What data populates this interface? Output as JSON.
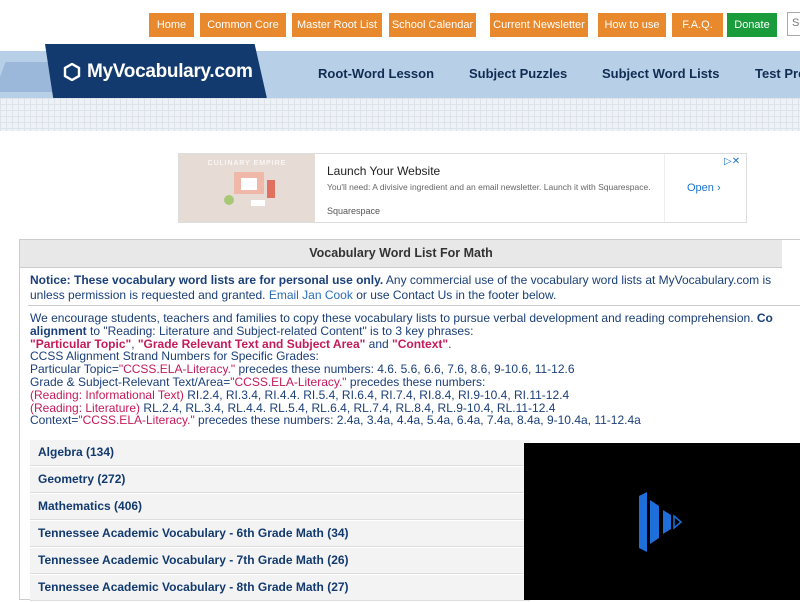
{
  "topnav": {
    "items": [
      "Home",
      "Common Core",
      "Master Root List",
      "School Calendar",
      "Current Newsletter",
      "How to use",
      "F.A.Q.",
      "Donate"
    ]
  },
  "search": {
    "placeholder": "Se"
  },
  "logo": {
    "text": "MyVocabulary.com"
  },
  "catnav": {
    "items": [
      "Root-Word Lesson",
      "Subject Puzzles",
      "Subject Word Lists",
      "Test Pre"
    ]
  },
  "ad": {
    "image_title": "CULINARY EMPIRE",
    "title": "Launch Your Website",
    "description": "You'll need: A divisive ingredient and an email newsletter. Launch it with Squarespace.",
    "brand": "Squarespace",
    "cta": "Open",
    "badges": "▷✕"
  },
  "main": {
    "header": "Vocabulary Word List For Math",
    "notice_bold": "Notice: These vocabulary word lists are for personal use only.",
    "notice_rest": " Any commercial use of the vocabulary word lists at MyVocabulary.com is",
    "notice_line2_a": "unless permission is requested and granted. ",
    "notice_link": "Email Jan Cook",
    "notice_line2_b": " or use Contact Us in the footer below.",
    "encourage": "We encourage students, teachers and families to copy these vocabulary lists to pursue verbal development and reading comprehension. ",
    "encourage_bold1": "Co",
    "alignment_bold": "alignment",
    "alignment_rest": " to \"Reading: Literature and Subject-related Content\" is to 3 key phrases:",
    "phrase1": "\"Particular Topic\"",
    "phrase2": "\"Grade Relevant Text and Subject Area\"",
    "phrase_and": " and ",
    "phrase3": "\"Context\"",
    "ccss_title": "CCSS Alignment Strand Numbers for Specific Grades:",
    "pt_a": "Particular Topic=",
    "pt_red": "\"CCSS.ELA-Literacy.\"",
    "pt_b": " precedes these numbers: 4.6. 5.6, 6.6, 7.6, 8.6, 9-10.6, 11-12.6",
    "gs_a": "Grade & Subject-Relevant Text/Area=",
    "gs_red": "\"CCSS.ELA-Literacy.\"",
    "gs_b": " precedes these numbers:",
    "ri_red": "(Reading: Informational Text)",
    "ri_b": " RI.2.4, RI.3.4, RI.4.4. RI.5.4, RI.6.4, RI.7.4, RI.8.4, RI.9-10.4, RI.11-12.4",
    "rl_red": "(Reading: Literature)",
    "rl_b": " RL.2.4, RL.3.4, RL.4.4. RL.5.4, RL.6.4, RL.7.4, RL.8.4, RL.9-10.4, RL.11-12.4",
    "ctx_a": "Context=",
    "ctx_red": "\"CCSS.ELA-Literacy.\"",
    "ctx_b": " precedes these numbers: 2.4a, 3.4a, 4.4a, 5.4a, 6.4a, 7.4a, 8.4a, 9-10.4a, 11-12.4a"
  },
  "subjects": [
    "Algebra (134)",
    "Geometry (272)",
    "Mathematics (406)",
    "Tennessee Academic Vocabulary - 6th Grade Math (34)",
    "Tennessee Academic Vocabulary - 7th Grade Math (26)",
    "Tennessee Academic Vocabulary - 8th Grade Math (27)"
  ],
  "colors": {
    "nav_orange": "#e8892e",
    "donate_green": "#1a9c3c",
    "logo_navy": "#123a6e",
    "banner_blue": "#b8cfe8",
    "accent_red": "#c41a5a",
    "video_blue": "#1e6fd9"
  }
}
